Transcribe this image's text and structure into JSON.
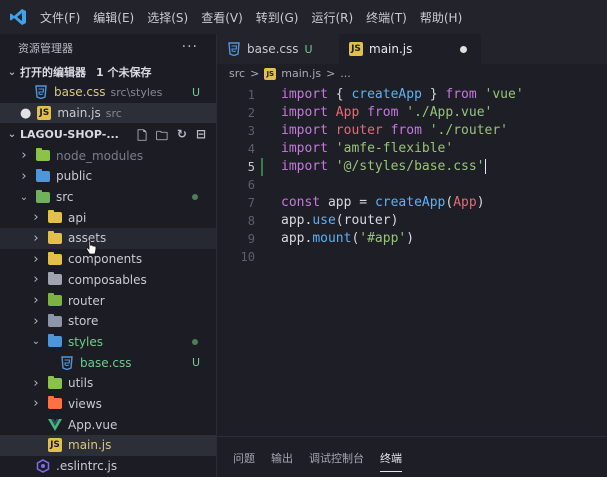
{
  "menu": [
    "文件(F)",
    "编辑(E)",
    "选择(S)",
    "查看(V)",
    "转到(G)",
    "运行(R)",
    "终端(T)",
    "帮助(H)"
  ],
  "sidebar": {
    "title": "资源管理器",
    "more": "···",
    "open_editors": {
      "label": "打开的编辑器",
      "unsaved": "1 个未保存",
      "items": [
        {
          "icon": "css-icon",
          "name": "base.css",
          "desc": "src\\styles",
          "status": "U"
        },
        {
          "icon": "js-icon",
          "name": "main.js",
          "desc": "src",
          "status": ""
        }
      ]
    },
    "project": {
      "name": "LAGOU-SHOP-...",
      "tree": [
        {
          "name": "node_modules",
          "type": "folder"
        },
        {
          "name": "public",
          "type": "folder"
        },
        {
          "name": "src",
          "type": "folder"
        },
        {
          "name": "api",
          "type": "folder"
        },
        {
          "name": "assets",
          "type": "folder"
        },
        {
          "name": "components",
          "type": "folder"
        },
        {
          "name": "composables",
          "type": "folder"
        },
        {
          "name": "router",
          "type": "folder"
        },
        {
          "name": "store",
          "type": "folder"
        },
        {
          "name": "styles",
          "type": "folder"
        },
        {
          "name": "base.css",
          "type": "file",
          "status": "U"
        },
        {
          "name": "utils",
          "type": "folder"
        },
        {
          "name": "views",
          "type": "folder"
        },
        {
          "name": "App.vue",
          "type": "file"
        },
        {
          "name": "main.js",
          "type": "file"
        },
        {
          "name": ".eslintrc.js",
          "type": "file"
        }
      ]
    }
  },
  "tabs": [
    {
      "label": "base.css",
      "status": "U"
    },
    {
      "label": "main.js",
      "status": ""
    }
  ],
  "breadcrumb": [
    "src",
    ">",
    "main.js",
    ">",
    "..."
  ],
  "editor": {
    "current_line": 5,
    "lines": [
      {
        "n": "1",
        "tokens": [
          [
            "kw",
            "import"
          ],
          [
            "plain",
            " { "
          ],
          [
            "fn",
            "createApp"
          ],
          [
            "plain",
            " } "
          ],
          [
            "kw",
            "from"
          ],
          [
            "plain",
            " "
          ],
          [
            "str",
            "'vue'"
          ]
        ]
      },
      {
        "n": "2",
        "tokens": [
          [
            "kw",
            "import"
          ],
          [
            "plain",
            " "
          ],
          [
            "var",
            "App"
          ],
          [
            "plain",
            " "
          ],
          [
            "kw",
            "from"
          ],
          [
            "plain",
            " "
          ],
          [
            "str",
            "'./App.vue'"
          ]
        ]
      },
      {
        "n": "3",
        "tokens": [
          [
            "kw",
            "import"
          ],
          [
            "plain",
            " "
          ],
          [
            "var",
            "router"
          ],
          [
            "plain",
            " "
          ],
          [
            "kw",
            "from"
          ],
          [
            "plain",
            " "
          ],
          [
            "str",
            "'./router'"
          ]
        ]
      },
      {
        "n": "4",
        "tokens": [
          [
            "kw",
            "import"
          ],
          [
            "plain",
            " "
          ],
          [
            "str",
            "'amfe-flexible'"
          ]
        ]
      },
      {
        "n": "5",
        "tokens": [
          [
            "kw",
            "import"
          ],
          [
            "plain",
            " "
          ],
          [
            "str",
            "'@/styles/base.css'"
          ]
        ]
      },
      {
        "n": "6",
        "tokens": []
      },
      {
        "n": "7",
        "tokens": [
          [
            "kw",
            "const"
          ],
          [
            "plain",
            " app = "
          ],
          [
            "fn",
            "createApp"
          ],
          [
            "plain",
            "("
          ],
          [
            "var",
            "App"
          ],
          [
            "plain",
            ")"
          ]
        ]
      },
      {
        "n": "8",
        "tokens": [
          [
            "plain",
            "app."
          ],
          [
            "fn",
            "use"
          ],
          [
            "plain",
            "(router)"
          ]
        ]
      },
      {
        "n": "9",
        "tokens": [
          [
            "plain",
            "app."
          ],
          [
            "fn",
            "mount"
          ],
          [
            "plain",
            "("
          ],
          [
            "str",
            "'#app'"
          ],
          [
            "plain",
            ")"
          ]
        ]
      },
      {
        "n": "10",
        "tokens": []
      }
    ]
  },
  "panel": {
    "tabs": [
      "问题",
      "输出",
      "调试控制台",
      "终端"
    ],
    "active": "终端"
  },
  "colors": {
    "js": "#e2c04a",
    "css": "#4f96d8",
    "vue": "#41b883",
    "untracked": "#73c991"
  }
}
